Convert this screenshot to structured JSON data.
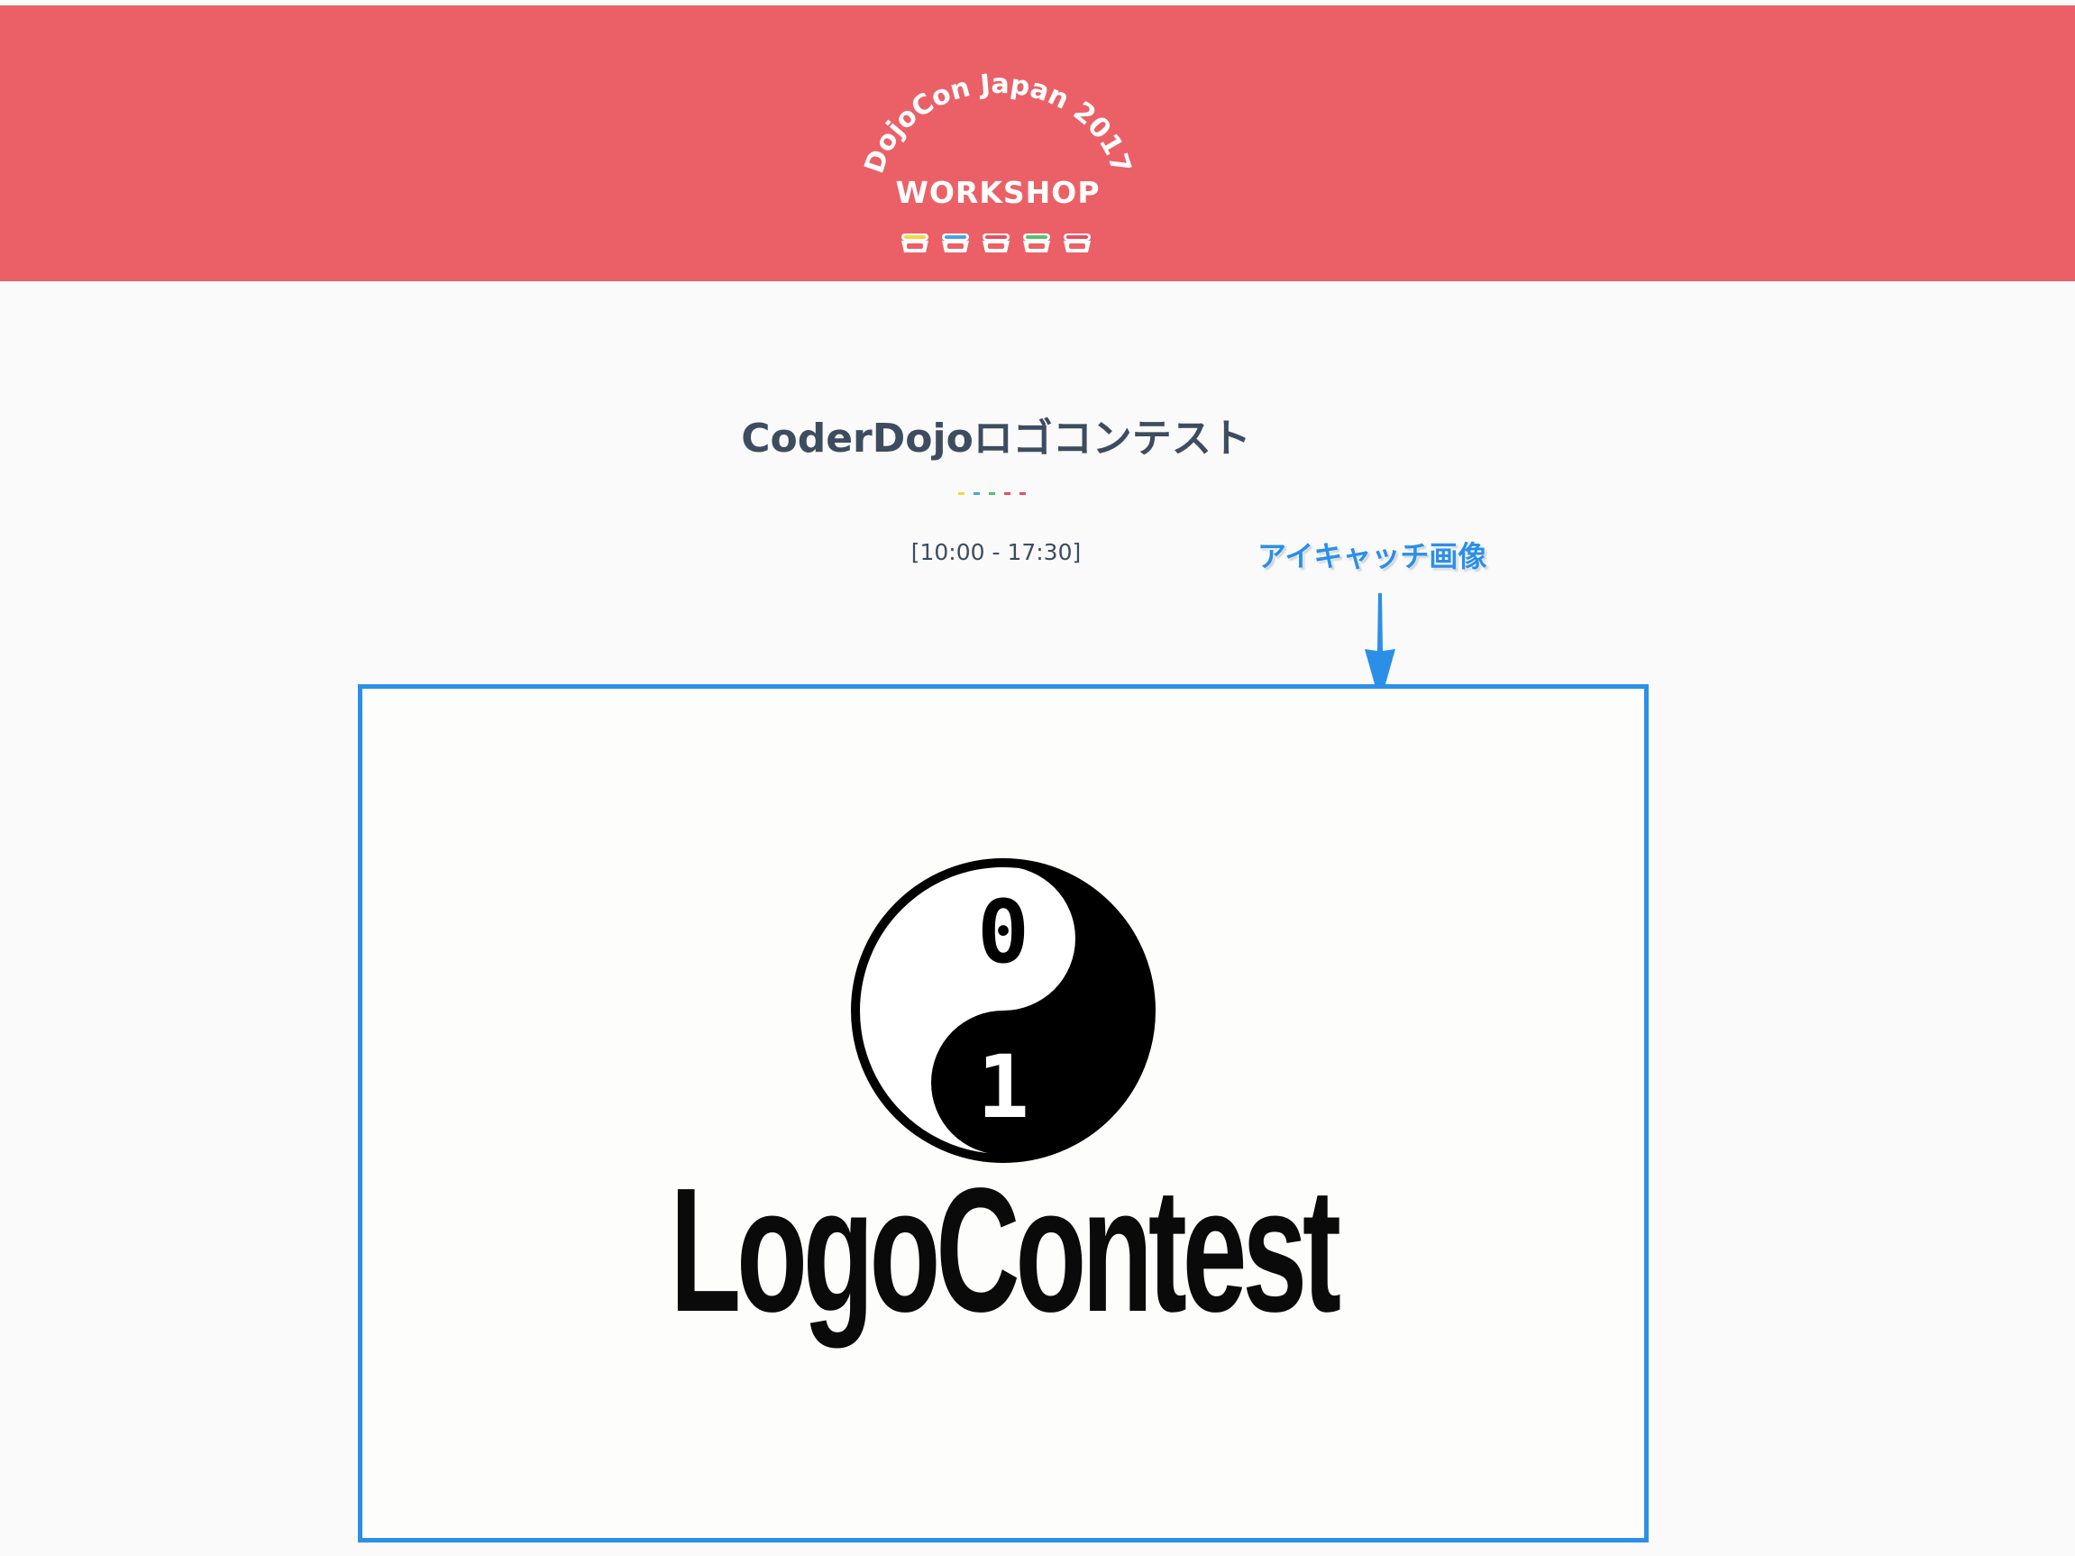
{
  "header": {
    "event_name": "DojoCon Japan 2017",
    "category": "WORKSHOP",
    "background_color": "#eb6066",
    "bowl_icon_count": 5,
    "bowl_accent_colors": [
      "#f5d547",
      "#4aa3df",
      "#e84e5e",
      "#5cbd6e",
      "#e84e5e"
    ]
  },
  "post": {
    "title": "CoderDojoロゴコンテスト",
    "time": "[10:00 - 17:30]",
    "divider_colors": [
      "#f5d547",
      "#4aa3df",
      "#5cbd6e",
      "#e84e5e",
      "#e84e5e"
    ]
  },
  "annotation": {
    "label": "アイキャッチ画像",
    "color": "#2b8fe8"
  },
  "eyecatch": {
    "logo_word": "LogoContest",
    "logo_digits": [
      "0",
      "1"
    ]
  }
}
